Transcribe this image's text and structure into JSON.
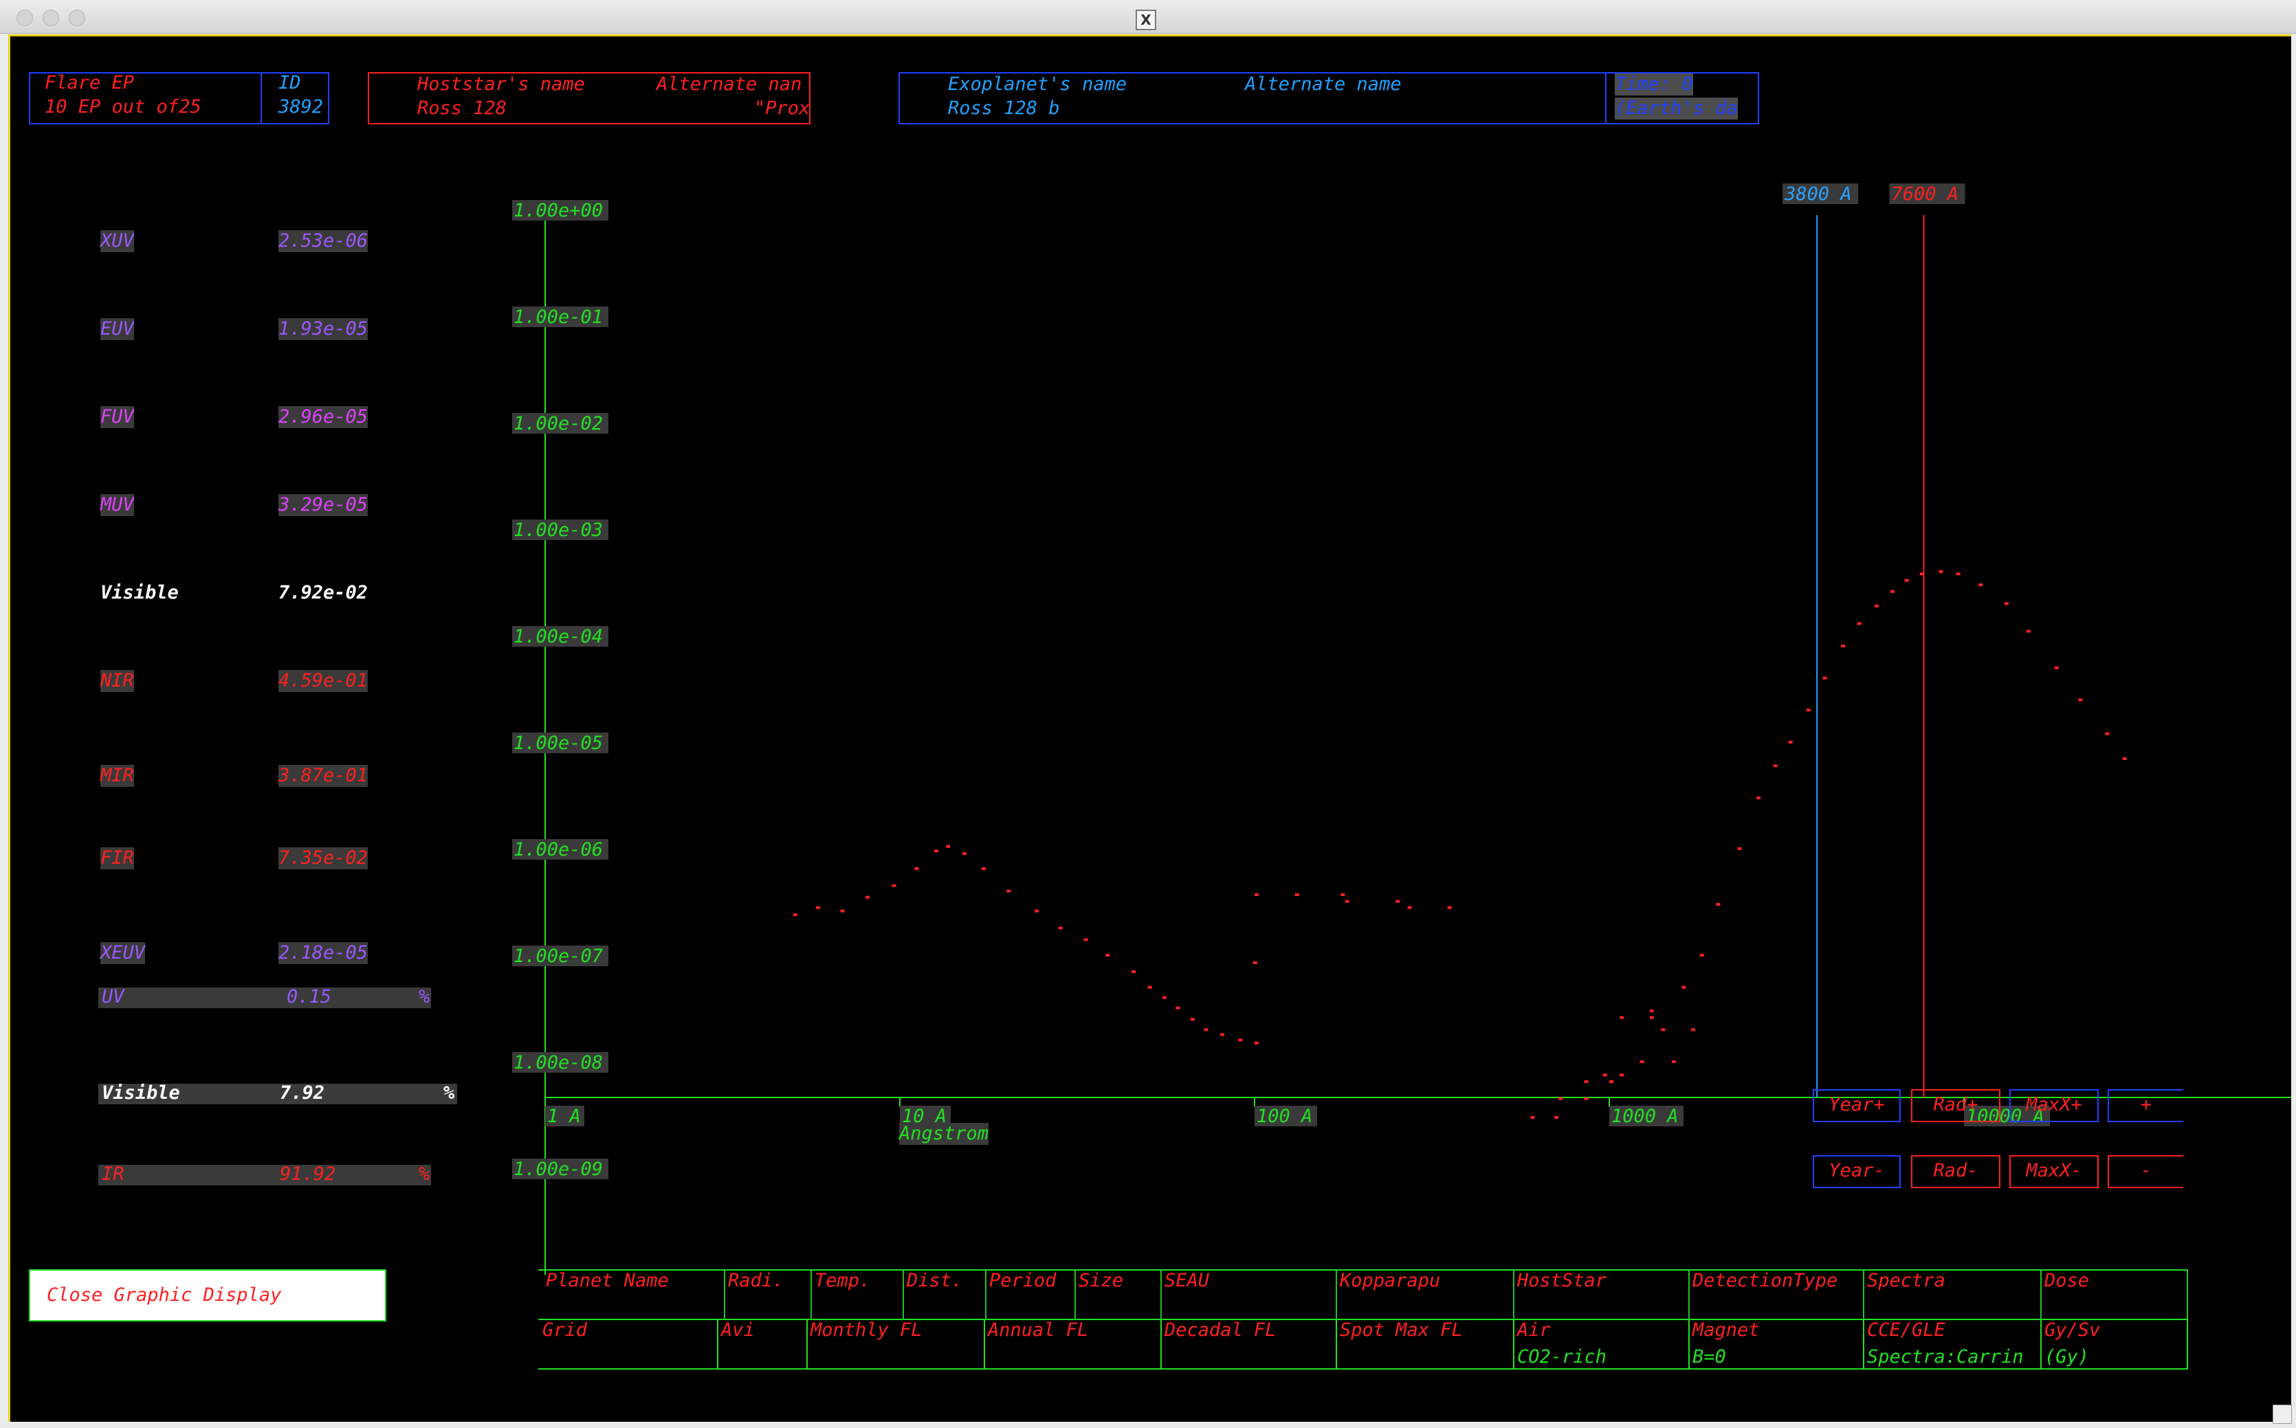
{
  "window": {
    "title_icon": "X"
  },
  "header": {
    "flare": {
      "title": "Flare EP",
      "line2": "10  EP out of25",
      "id_label": "ID",
      "id_value": "3892"
    },
    "hoststar": {
      "name_label": "Hoststar's name",
      "alt_label": "Alternate nan",
      "name": "Ross 128",
      "alt": "\"Prox"
    },
    "exoplanet": {
      "name_label": "Exoplanet's name",
      "alt_label": "Alternate name",
      "name": "Ross 128 b",
      "time_label": "Time: 0",
      "time_unit": "(Earth's da"
    }
  },
  "bands": [
    {
      "label": "XUV",
      "value": "2.53e-06",
      "color": "#9a58ff"
    },
    {
      "label": "EUV",
      "value": "1.93e-05",
      "color": "#9a58ff"
    },
    {
      "label": "FUV",
      "value": "2.96e-05",
      "color": "#e040ff"
    },
    {
      "label": "MUV",
      "value": "3.29e-05",
      "color": "#e040ff"
    },
    {
      "label": "Visible",
      "value": "7.92e-02",
      "color": "#ffffff"
    },
    {
      "label": "NIR",
      "value": "4.59e-01",
      "color": "#ff2020"
    },
    {
      "label": "MIR",
      "value": "3.87e-01",
      "color": "#ff2020"
    },
    {
      "label": "FIR",
      "value": "7.35e-02",
      "color": "#ff2020"
    },
    {
      "label": "XEUV",
      "value": "2.18e-05",
      "color": "#9a58ff"
    }
  ],
  "percent": {
    "uv": {
      "label": "UV",
      "value": "0.15",
      "unit": "%"
    },
    "visible": {
      "label": "Visible",
      "value": "7.92",
      "unit": "%"
    },
    "ir": {
      "label": "IR",
      "value": "91.92",
      "unit": "%"
    }
  },
  "close_button": "Close Graphic Display",
  "chart_data": {
    "type": "scatter",
    "y_scale": "log",
    "x_scale": "log",
    "ylim": [
      1e-09,
      1
    ],
    "xlim": [
      1,
      30000
    ],
    "y_ticks": [
      "1.00e+00",
      "1.00e-01",
      "1.00e-02",
      "1.00e-03",
      "1.00e-04",
      "1.00e-05",
      "1.00e-06",
      "1.00e-07",
      "1.00e-08",
      "1.00e-09"
    ],
    "x_ticks": [
      "1 A",
      "10 A",
      "100 A",
      "1000 A",
      "10000 A"
    ],
    "xlabel": "Angstrom",
    "markers": [
      {
        "label": "3800 A",
        "x": 3800,
        "color": "#2aa0ff"
      },
      {
        "label": "7600 A",
        "x": 7600,
        "color": "#ff2020"
      }
    ],
    "series": [
      {
        "color": "#ff2020",
        "points": [
          [
            5,
            2.4e-07
          ],
          [
            5.8,
            2.8e-07
          ],
          [
            6.8,
            2.6e-07
          ],
          [
            8,
            3.5e-07
          ],
          [
            9.5,
            4.5e-07
          ],
          [
            11,
            6.5e-07
          ],
          [
            12.5,
            9.5e-07
          ],
          [
            13.5,
            1.05e-06
          ],
          [
            15,
            9e-07
          ],
          [
            17,
            6.5e-07
          ],
          [
            20,
            4e-07
          ],
          [
            24,
            2.6e-07
          ],
          [
            28,
            1.8e-07
          ],
          [
            33,
            1.4e-07
          ],
          [
            38,
            1e-07
          ],
          [
            45,
            7e-08
          ],
          [
            50,
            5e-08
          ],
          [
            55,
            4e-08
          ],
          [
            60,
            3.2e-08
          ],
          [
            66,
            2.5e-08
          ],
          [
            72,
            2e-08
          ],
          [
            80,
            1.8e-08
          ],
          [
            90,
            1.6e-08
          ],
          [
            100,
            1.5e-08
          ],
          [
            99,
            8.5e-08
          ],
          [
            100,
            3.7e-07
          ],
          [
            130,
            3.7e-07
          ],
          [
            175,
            3.7e-07
          ],
          [
            180,
            3.2e-07
          ],
          [
            250,
            3.2e-07
          ],
          [
            270,
            2.8e-07
          ],
          [
            350,
            2.8e-07
          ],
          [
            600,
            3e-09
          ],
          [
            700,
            3e-09
          ],
          [
            720,
            4.5e-09
          ],
          [
            850,
            4.5e-09
          ],
          [
            850,
            6.5e-09
          ],
          [
            1000,
            6.5e-09
          ],
          [
            960,
            7.5e-09
          ],
          [
            1070,
            7.5e-09
          ],
          [
            1070,
            2.6e-08
          ],
          [
            1300,
            2.6e-08
          ],
          [
            1220,
            1e-08
          ],
          [
            1300,
            3e-08
          ],
          [
            1400,
            2e-08
          ],
          [
            1500,
            1e-08
          ],
          [
            1600,
            5e-08
          ],
          [
            1700,
            2e-08
          ],
          [
            1800,
            1e-07
          ],
          [
            2000,
            3e-07
          ],
          [
            2300,
            1e-06
          ],
          [
            2600,
            3e-06
          ],
          [
            2900,
            6e-06
          ],
          [
            3200,
            1e-05
          ],
          [
            3600,
            2e-05
          ],
          [
            4000,
            4e-05
          ],
          [
            4500,
            8e-05
          ],
          [
            5000,
            0.00013
          ],
          [
            5600,
            0.00019
          ],
          [
            6200,
            0.00026
          ],
          [
            6800,
            0.00033
          ],
          [
            7500,
            0.00038
          ],
          [
            8500,
            0.0004
          ],
          [
            9500,
            0.00038
          ],
          [
            11000,
            0.0003
          ],
          [
            13000,
            0.0002
          ],
          [
            15000,
            0.00011
          ],
          [
            18000,
            5e-05
          ],
          [
            21000,
            2.5e-05
          ],
          [
            25000,
            1.2e-05
          ],
          [
            28000,
            7e-06
          ]
        ]
      }
    ]
  },
  "controls": {
    "row1": [
      {
        "label": "Year+",
        "color": "#ff2020",
        "border": "#2040ff"
      },
      {
        "label": "Rad+",
        "color": "#ff2020",
        "border": "#ff2020"
      },
      {
        "label": "MaxX+",
        "color": "#ff2020",
        "border": "#2040ff"
      },
      {
        "label": "+",
        "color": "#ff2020",
        "border": "#2040ff"
      }
    ],
    "row2": [
      {
        "label": "Year-",
        "color": "#ff2020",
        "border": "#2040ff"
      },
      {
        "label": "Rad-",
        "color": "#ff2020",
        "border": "#ff2020"
      },
      {
        "label": "MaxX-",
        "color": "#ff2020",
        "border": "#ff2020"
      },
      {
        "label": "-",
        "color": "#ff2020",
        "border": "#ff2020"
      }
    ]
  },
  "table": {
    "row1": [
      "Planet Name",
      "Radi.",
      "Temp.",
      "Dist.",
      "Period",
      "Size",
      "SEAU",
      "Kopparapu",
      "HostStar",
      "DetectionType",
      "Spectra",
      "Dose"
    ],
    "row2": [
      "Grid",
      "Avi",
      "Monthly FL",
      "Annual FL",
      "Decadal FL",
      "Spot Max FL",
      "Air",
      "Magnet",
      "CCE/GLE",
      "Gy/Sv"
    ],
    "row2b": [
      "CO2-rich",
      "B=0",
      "Spectra:Carrin",
      "(Gy)"
    ]
  }
}
